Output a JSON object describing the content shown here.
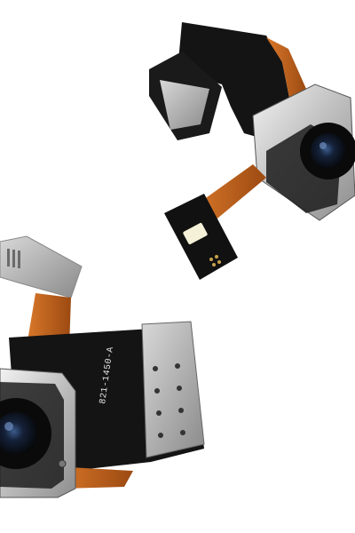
{
  "photo": {
    "subject_1": "rear-camera-module-with-flash",
    "subject_2": "rear-camera-module-with-bracket",
    "part_number": "821-1450-A",
    "colors": {
      "background": "#ffffff",
      "flex_orange": "#c0641c",
      "flex_black": "#141414",
      "metal": "#c9c9c9",
      "lens": "#1a2a44"
    }
  }
}
